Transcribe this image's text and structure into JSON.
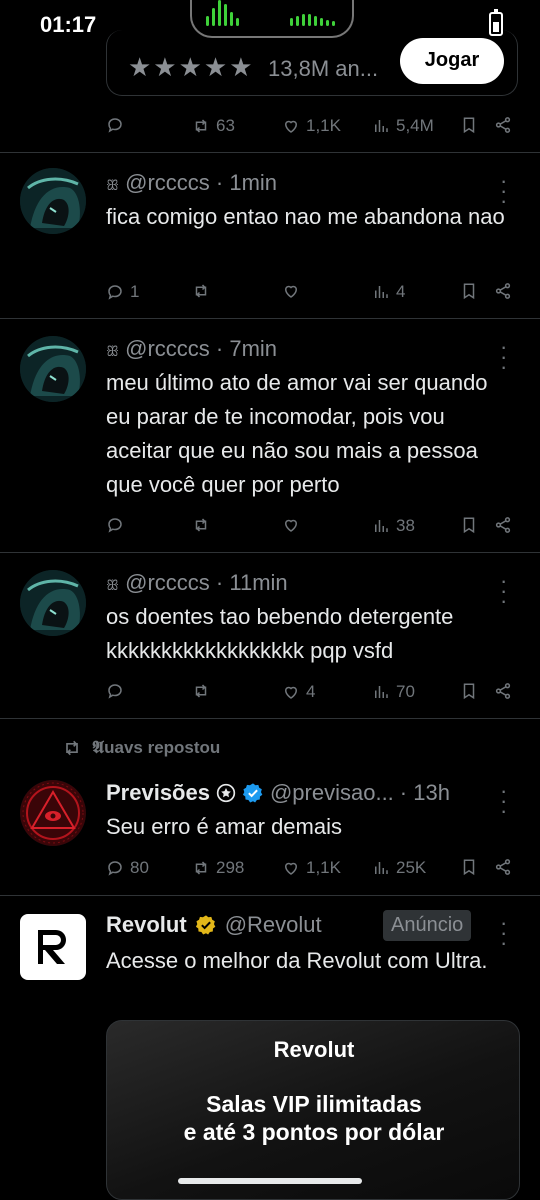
{
  "status": {
    "time": "01:17"
  },
  "top_card": {
    "stars": "★★★★★",
    "rating": "13,8M an...",
    "button": "Jogar"
  },
  "top_actions": {
    "retweets": "63",
    "likes": "1,1K",
    "views": "5,4M"
  },
  "tweets": [
    {
      "handle": "@rccccs",
      "time": "· 1min",
      "text": "fica comigo entao nao me abandona nao",
      "replies": "1",
      "retweets": "",
      "likes": "",
      "views": "4"
    },
    {
      "handle": "@rccccs",
      "time": "· 7min",
      "text": "meu último ato de amor vai ser quando eu parar de te incomodar, pois vou aceitar que eu não sou mais a pessoa que você quer por perto",
      "replies": "",
      "retweets": "",
      "likes": "",
      "views": "38"
    },
    {
      "handle": "@rccccs",
      "time": "· 11min",
      "text": "os doentes tao bebendo detergente kkkkkkkkkkkkkkkkkk pqp vsfd",
      "replies": "",
      "retweets": "",
      "likes": "4",
      "views": "70"
    }
  ],
  "repost": {
    "reposter": "𝕬uavs repostou",
    "name": "Previsões",
    "handle": "@previsao...",
    "time": "· 13h",
    "text": "Seu erro é amar demais",
    "replies": "80",
    "retweets": "298",
    "likes": "1,1K",
    "views": "25K"
  },
  "ad": {
    "name": "Revolut",
    "handle": "@Revolut",
    "badge": "Anúncio",
    "text": "Acesse o melhor da Revolut com Ultra.",
    "card_brand": "Revolut",
    "card_line1": "Salas VIP ilimitadas",
    "card_line2": "e até 3 pontos por dólar"
  },
  "colors": {
    "background": "#000000",
    "muted": "#71767b",
    "verified": "#1d9bf0",
    "gold": "#e2b719",
    "wave": "#3fd13a"
  }
}
